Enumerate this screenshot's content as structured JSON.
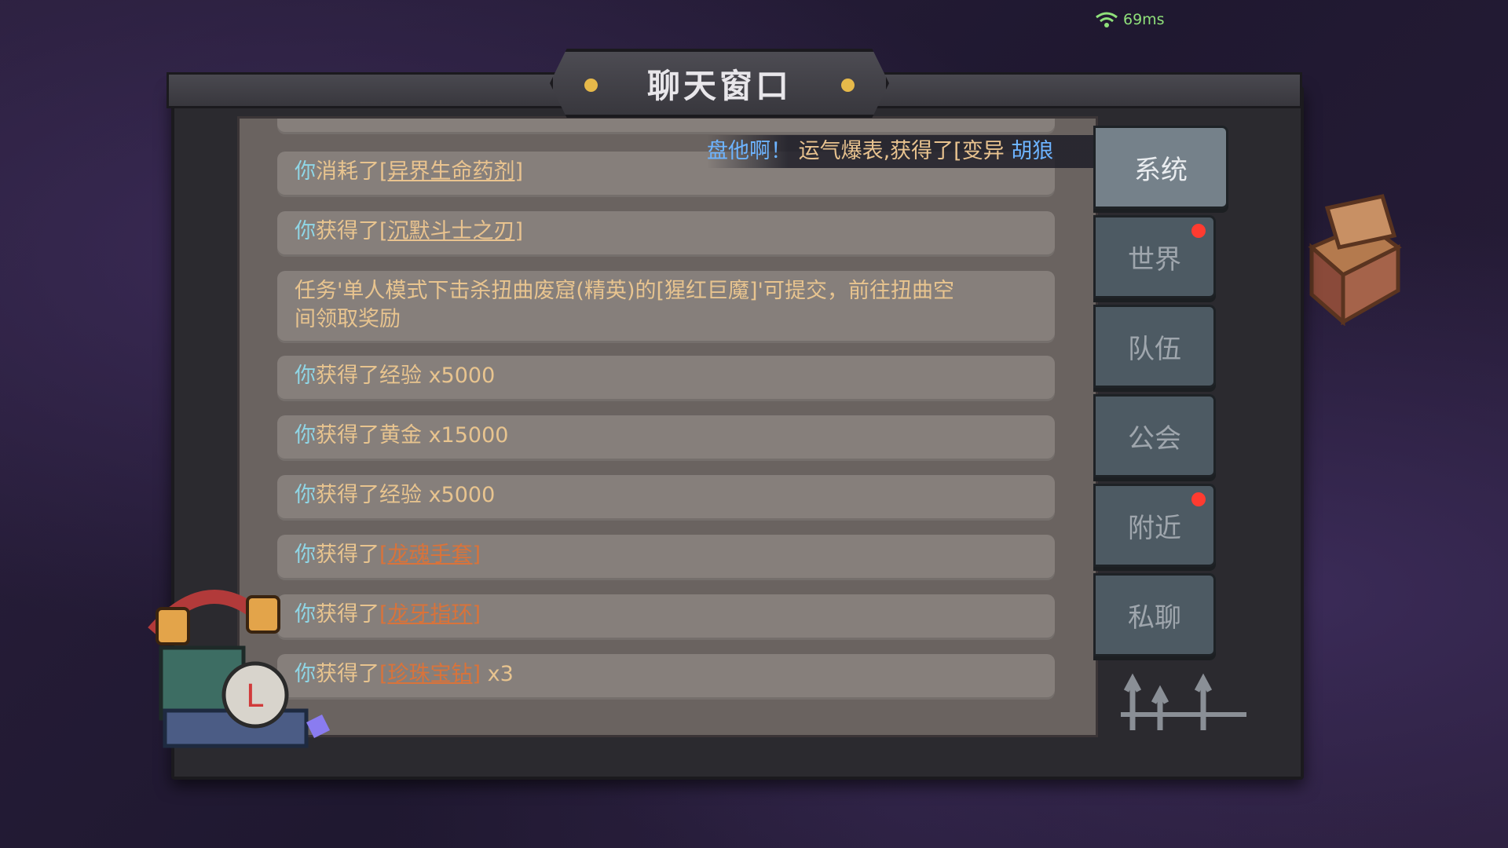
{
  "status": {
    "latency": "69ms",
    "wifi_icon": "wifi-icon"
  },
  "window": {
    "title": "聊天窗口"
  },
  "broadcast": {
    "part1": "盘他啊！",
    "part2": "运气爆表,获得了[变异 ",
    "part3": "胡狼"
  },
  "messages": [
    {
      "pre": "你",
      "verb": "消耗了",
      "item": "[异界生命药剂]",
      "item_color": "yellow",
      "suffix": ""
    },
    {
      "pre": "你",
      "verb": "获得了",
      "item": "[沉默斗士之刃]",
      "item_color": "yellow",
      "suffix": ""
    },
    {
      "text": "任务'单人模式下击杀扭曲废窟(精英)的[猩红巨魔]'可提交，前往扭曲空\n间领取奖励"
    },
    {
      "pre": "你",
      "verb": "获得了经验",
      "item": "",
      "item_color": "",
      "suffix": " x5000"
    },
    {
      "pre": "你",
      "verb": "获得了黄金",
      "item": "",
      "item_color": "",
      "suffix": " x15000"
    },
    {
      "pre": "你",
      "verb": "获得了经验",
      "item": "",
      "item_color": "",
      "suffix": " x5000"
    },
    {
      "pre": "你",
      "verb": "获得了",
      "item": "[龙魂手套]",
      "item_color": "orange",
      "suffix": ""
    },
    {
      "pre": "你",
      "verb": "获得了",
      "item": "[龙牙指环]",
      "item_color": "orange",
      "suffix": ""
    },
    {
      "pre": "你",
      "verb": "获得了",
      "item": "[珍珠宝钻]",
      "item_color": "orange",
      "suffix": " x3"
    }
  ],
  "tabs": [
    {
      "label": "系统",
      "active": true,
      "badge": false
    },
    {
      "label": "世界",
      "active": false,
      "badge": true
    },
    {
      "label": "队伍",
      "active": false,
      "badge": false
    },
    {
      "label": "公会",
      "active": false,
      "badge": false
    },
    {
      "label": "附近",
      "active": false,
      "badge": true
    },
    {
      "label": "私聊",
      "active": false,
      "badge": false
    }
  ],
  "colors": {
    "you": "#8fd6e6",
    "item_yellow": "#e9c38f",
    "item_orange": "#d9733a",
    "badge": "#ff3b30"
  }
}
